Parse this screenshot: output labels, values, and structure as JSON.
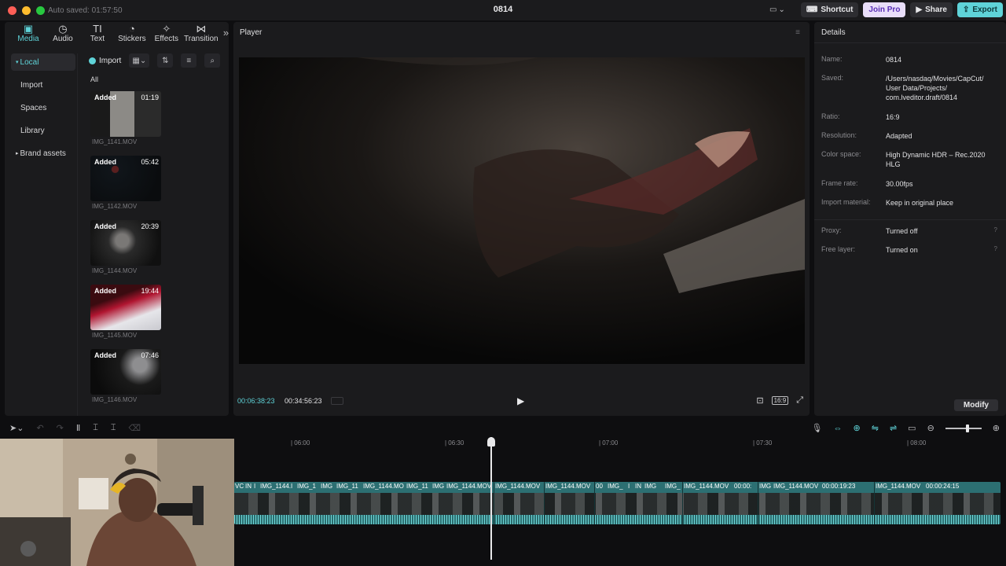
{
  "titlebar": {
    "autosave": "Auto saved: 01:57:50",
    "project_title": "0814",
    "shortcut": "Shortcut",
    "join_pro": "Join Pro",
    "share": "Share",
    "export": "Export"
  },
  "tabs": [
    {
      "label": "Media",
      "icon": "media-icon",
      "glyph": "▣"
    },
    {
      "label": "Audio",
      "icon": "audio-icon",
      "glyph": "◷"
    },
    {
      "label": "Text",
      "icon": "text-icon",
      "glyph": "TI"
    },
    {
      "label": "Stickers",
      "icon": "stickers-icon",
      "glyph": "◔"
    },
    {
      "label": "Effects",
      "icon": "effects-icon",
      "glyph": "✧"
    },
    {
      "label": "Transition",
      "icon": "transition-icon",
      "glyph": "⋈"
    }
  ],
  "sidenav": {
    "local": "Local",
    "import": "Import",
    "spaces": "Spaces",
    "library": "Library",
    "brand_assets": "Brand assets"
  },
  "media": {
    "import_label": "Import",
    "filter_label": "All",
    "clips": [
      {
        "status": "Added",
        "duration": "01:19",
        "name": "IMG_1141.MOV"
      },
      {
        "status": "Added",
        "duration": "05:42",
        "name": "IMG_1142.MOV"
      },
      {
        "status": "Added",
        "duration": "20:39",
        "name": "IMG_1144.MOV"
      },
      {
        "status": "Added",
        "duration": "19:44",
        "name": "IMG_1145.MOV"
      },
      {
        "status": "Added",
        "duration": "07:46",
        "name": "IMG_1146.MOV"
      }
    ]
  },
  "player": {
    "title": "Player",
    "current_time": "00:06:38:23",
    "total_time": "00:34:56:23",
    "ratio_tag": "16:9"
  },
  "details": {
    "title": "Details",
    "rows": [
      {
        "key": "Name:",
        "value": "0814"
      },
      {
        "key": "Saved:",
        "value": "/Users/nasdaq/Movies/CapCut/ User Data/Projects/ com.lveditor.draft/0814"
      },
      {
        "key": "Ratio:",
        "value": "16:9"
      },
      {
        "key": "Resolution:",
        "value": "Adapted"
      },
      {
        "key": "Color space:",
        "value": "High Dynamic HDR – Rec.2020 HLG"
      },
      {
        "key": "Frame rate:",
        "value": "30.00fps"
      },
      {
        "key": "Import material:",
        "value": "Keep in original place"
      },
      {
        "key": "Proxy:",
        "value": "Turned off"
      },
      {
        "key": "Free layer:",
        "value": "Turned on"
      }
    ],
    "modify": "Modify"
  },
  "timeline": {
    "ruler": [
      "| 06:00",
      "| 06:30",
      "| 07:00",
      "| 07:30",
      "| 08:00"
    ],
    "segments": [
      "VC",
      "IN",
      "I",
      "IMG_1144.I",
      "IMG_1",
      "IMG",
      "IMG_11",
      "IMG_1144.MO",
      "IMG_11",
      "IMG",
      "IMG_1144.MOV",
      "IMG_1144.MOV",
      "IMG_1144.MOV",
      "00",
      "IMG_",
      "I",
      "IN",
      "IMG",
      "IMG_",
      "IMG_1144.MOV",
      "00:00:",
      "IMG",
      "IMG_1144.MOV",
      "00:00:19:23",
      "IMG_1144.MOV",
      "00:00:24:15"
    ]
  },
  "colors": {
    "accent": "#5fd3d8",
    "panel": "#1b1b1d",
    "background": "#0e0e10",
    "track": "#2c6f72"
  }
}
